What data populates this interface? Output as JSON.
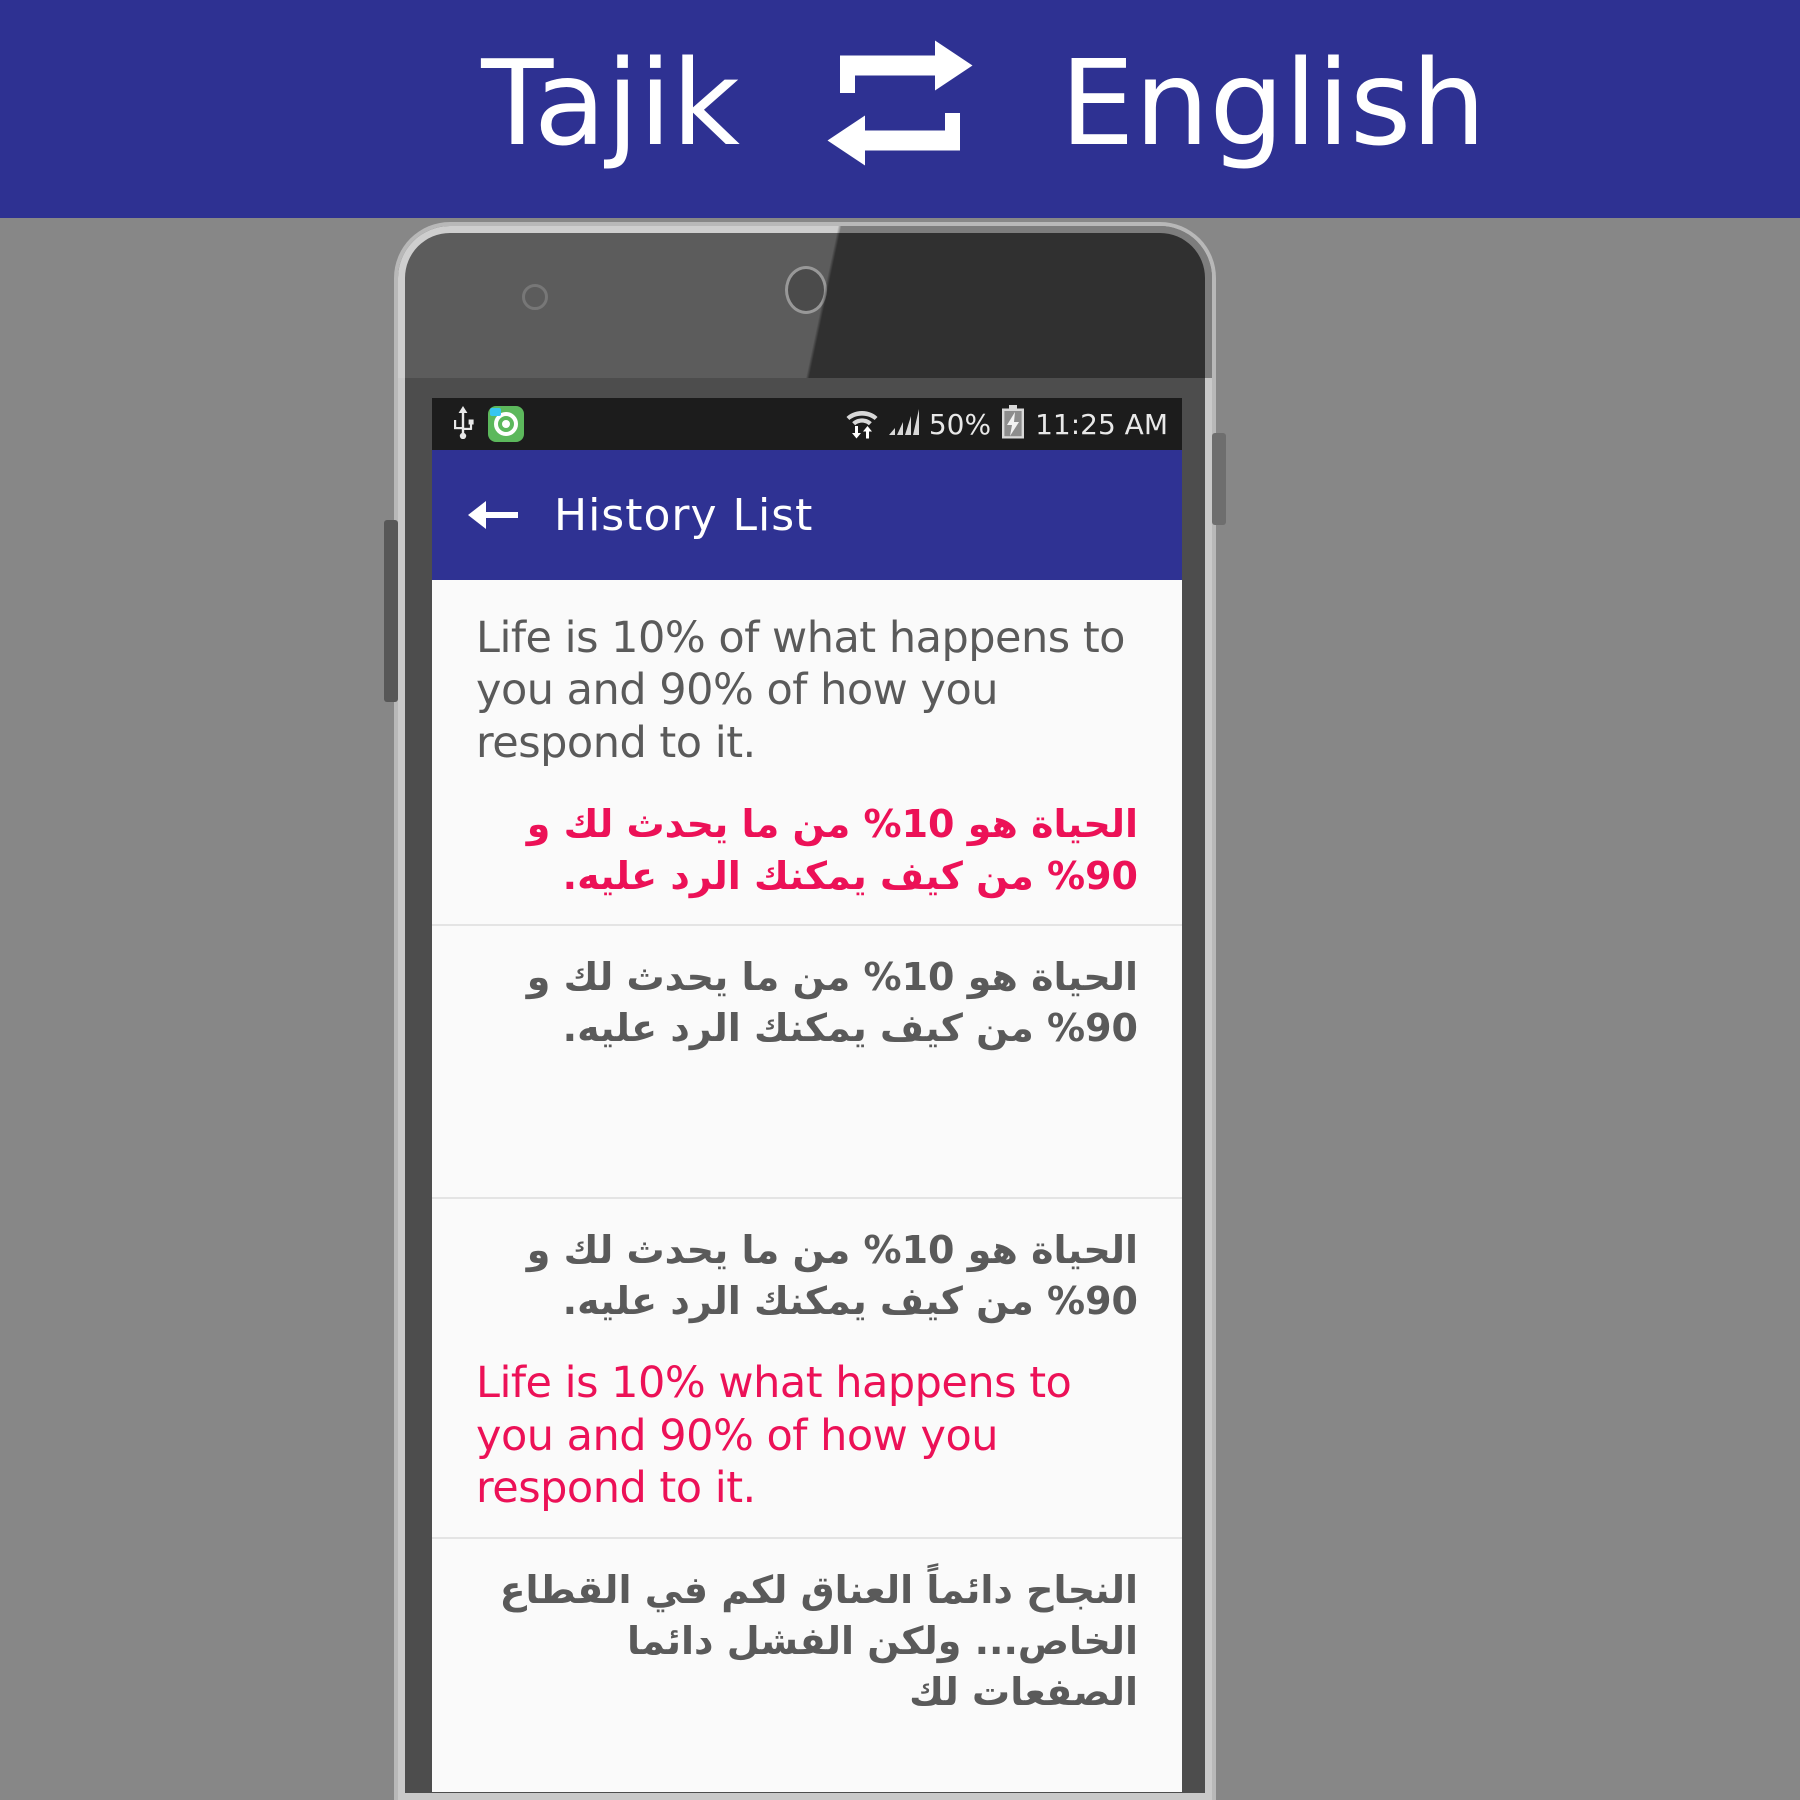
{
  "banner": {
    "source_language": "Tajik",
    "swap_icon": "repeat-swap-icon",
    "target_language": "English",
    "background_color": "#2e3192",
    "text_color": "#ffffff"
  },
  "device": {
    "camera_icon": "front-camera-icon",
    "speaker_icon": "earpiece-speaker-icon"
  },
  "status_bar": {
    "usb_icon": "usb-icon",
    "app_icon": "app-notification-icon",
    "wifi_icon": "wifi-transfer-icon",
    "signal_icon": "cellular-signal-icon",
    "battery_percent": "50%",
    "battery_icon": "battery-charging-icon",
    "time": "11:25 AM",
    "background_color": "#1c1c1c"
  },
  "app_bar": {
    "back_icon": "back-arrow-icon",
    "title": "History List",
    "background_color": "#2f3293"
  },
  "colors": {
    "accent": "#ec1157",
    "body_text": "#5a5a5a",
    "screen_background": "#fafafa",
    "page_background": "#878787"
  },
  "history": {
    "items": [
      {
        "id": "item-1",
        "source_text": "Life is 10% of what happens to you and 90% of how you respond to it.",
        "source_color": "#5a5a5a",
        "source_dir": "ltr",
        "translation_text": "الحياة هو 10% من ما يحدث لك و 90% من كيف يمكنك الرد عليه.",
        "translation_color": "#ec1157",
        "translation_dir": "rtl"
      },
      {
        "id": "item-2",
        "source_text": "الحياة هو 10% من ما يحدث لك و 90% من كيف يمكنك الرد عليه.",
        "source_color": "#5a5a5a",
        "source_dir": "rtl",
        "translation_text": "",
        "translation_color": "#5a5a5a",
        "translation_dir": "rtl"
      },
      {
        "id": "item-3",
        "source_text": "الحياة هو 10% من ما يحدث لك و 90% من كيف يمكنك الرد عليه.",
        "source_color": "#5a5a5a",
        "source_dir": "rtl",
        "translation_text": "Life is 10% what happens to you and 90% of how you respond to it.",
        "translation_color": "#ec1157",
        "translation_dir": "ltr"
      },
      {
        "id": "item-4",
        "source_text": "النجاح دائماً العناق لكم في القطاع الخاص... ولكن الفشل دائما الصفعات لك",
        "source_color": "#5a5a5a",
        "source_dir": "rtl",
        "translation_text": "",
        "translation_color": "#5a5a5a",
        "translation_dir": "rtl"
      }
    ]
  }
}
